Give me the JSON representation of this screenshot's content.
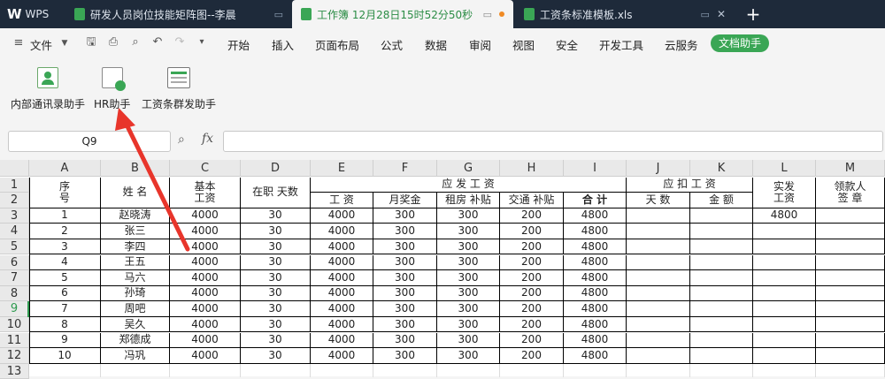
{
  "titlebar": {
    "tabs": [
      {
        "label": "WPS"
      },
      {
        "label": "研发人员岗位技能矩阵图--李晨"
      },
      {
        "label": "工作簿 12月28日15时52分50秒"
      },
      {
        "label": "工资条标准模板.xls"
      }
    ],
    "new_tab": "+"
  },
  "menubar": {
    "file": "文件",
    "items": [
      "开始",
      "插入",
      "页面布局",
      "公式",
      "数据",
      "审阅",
      "视图",
      "安全",
      "开发工具",
      "云服务",
      "文档助手"
    ]
  },
  "ribbon": {
    "buttons": [
      {
        "label": "内部通讯录助手"
      },
      {
        "label": "HR助手"
      },
      {
        "label": "工资条群发助手"
      }
    ]
  },
  "formula_bar": {
    "name_box": "Q9",
    "fx": "fx",
    "content": ""
  },
  "sheet": {
    "columns": [
      "A",
      "B",
      "C",
      "D",
      "E",
      "F",
      "G",
      "H",
      "I",
      "J",
      "K",
      "L",
      "M"
    ],
    "rows": [
      "1",
      "2",
      "3",
      "4",
      "5",
      "6",
      "7",
      "8",
      "9",
      "10",
      "11",
      "12",
      "13"
    ],
    "selected_row": "9",
    "header": {
      "seq": "序\n号",
      "name": "姓  名",
      "base": "基本\n工资",
      "days": "在职  天数",
      "payable": "应 发 工 资",
      "wage": "工   资",
      "bonus": "月奖金",
      "rent": "租房   补贴",
      "traffic": "交通   补贴",
      "total": "合   计",
      "deduct": "应 扣 工 资",
      "ded_days": "天   数",
      "ded_amount": "金   额",
      "actual": "实发\n工资",
      "sign": "领款人\n签   章"
    },
    "data": [
      [
        "1",
        "赵晓涛",
        "4000",
        "30",
        "4000",
        "300",
        "300",
        "200",
        "4800",
        "",
        "",
        "4800",
        ""
      ],
      [
        "2",
        "张三",
        "4000",
        "30",
        "4000",
        "300",
        "300",
        "200",
        "4800",
        "",
        "",
        "",
        ""
      ],
      [
        "3",
        "李四",
        "4000",
        "30",
        "4000",
        "300",
        "300",
        "200",
        "4800",
        "",
        "",
        "",
        ""
      ],
      [
        "4",
        "王五",
        "4000",
        "30",
        "4000",
        "300",
        "300",
        "200",
        "4800",
        "",
        "",
        "",
        ""
      ],
      [
        "5",
        "马六",
        "4000",
        "30",
        "4000",
        "300",
        "300",
        "200",
        "4800",
        "",
        "",
        "",
        ""
      ],
      [
        "6",
        "孙琦",
        "4000",
        "30",
        "4000",
        "300",
        "300",
        "200",
        "4800",
        "",
        "",
        "",
        ""
      ],
      [
        "7",
        "周吧",
        "4000",
        "30",
        "4000",
        "300",
        "300",
        "200",
        "4800",
        "",
        "",
        "",
        ""
      ],
      [
        "8",
        "吴久",
        "4000",
        "30",
        "4000",
        "300",
        "300",
        "200",
        "4800",
        "",
        "",
        "",
        ""
      ],
      [
        "9",
        "郑德成",
        "4000",
        "30",
        "4000",
        "300",
        "300",
        "200",
        "4800",
        "",
        "",
        "",
        ""
      ],
      [
        "10",
        "冯巩",
        "4000",
        "30",
        "4000",
        "300",
        "300",
        "200",
        "4800",
        "",
        "",
        "",
        ""
      ]
    ]
  },
  "colors": {
    "accent": "#3aa655",
    "titlebar": "#1e2a3a",
    "arrow": "#e8352b"
  }
}
